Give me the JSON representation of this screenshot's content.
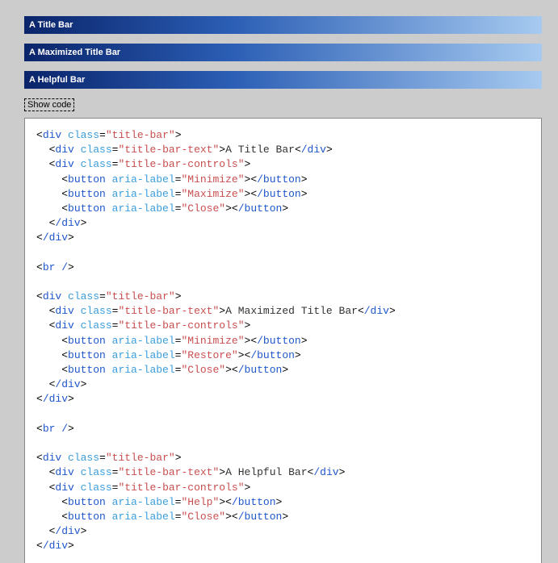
{
  "bars": [
    {
      "text": "A Title Bar"
    },
    {
      "text": "A Maximized Title Bar"
    },
    {
      "text": "A Helpful Bar"
    }
  ],
  "show_code_label": "Show code",
  "code": {
    "b1_title": "A Title Bar",
    "b2_title": "A Maximized Title Bar",
    "b3_title": "A Helpful Bar",
    "cls_bar": "title-bar",
    "cls_text": "title-bar-text",
    "cls_ctrl": "title-bar-controls",
    "attr_label": "aria-label",
    "lbl_min": "Minimize",
    "lbl_max": "Maximize",
    "lbl_restore": "Restore",
    "lbl_close": "Close",
    "lbl_help": "Help",
    "tag_div_open": "div",
    "tag_div_close": "/div",
    "tag_btn_open": "button",
    "tag_btn_close": "/button",
    "tag_br": "br /",
    "attr_class": "class"
  }
}
